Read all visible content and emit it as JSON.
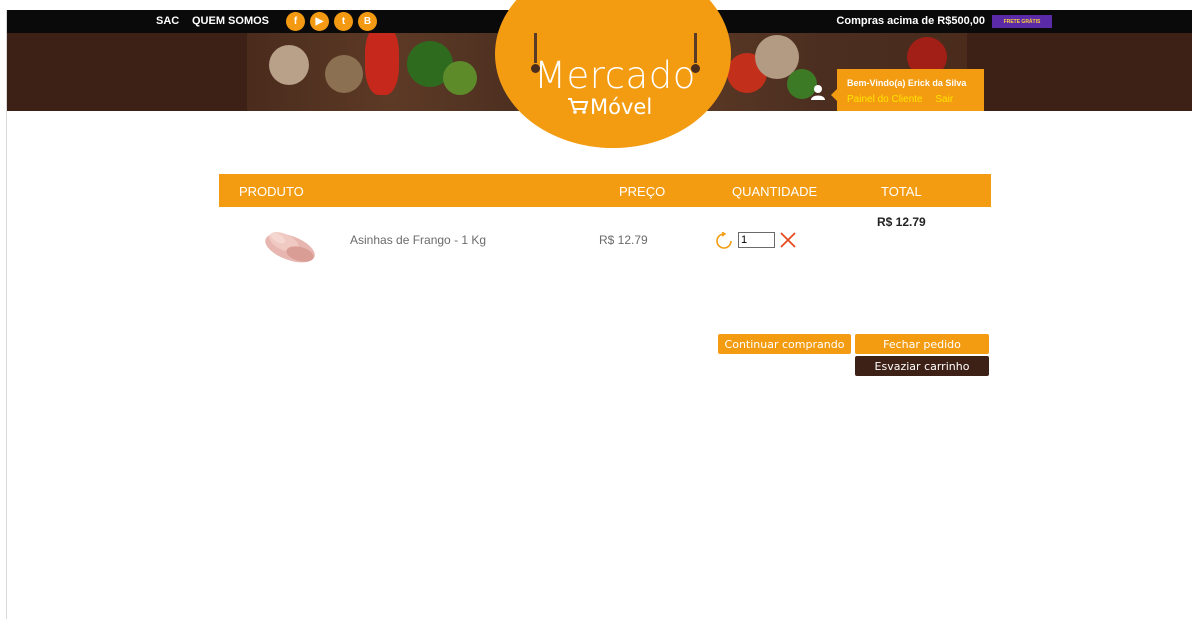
{
  "topbar": {
    "links": [
      "SAC",
      "QUEM SOMOS"
    ],
    "social": [
      {
        "icon": "facebook-icon",
        "glyph": "f"
      },
      {
        "icon": "youtube-icon",
        "glyph": "▶"
      },
      {
        "icon": "twitter-icon",
        "glyph": "t"
      },
      {
        "icon": "blog-icon",
        "glyph": "B"
      }
    ],
    "promo": "Compras acima de R$500,00",
    "badge": "FRETE GRÁTIS"
  },
  "logo": {
    "line1": "Mercado",
    "line2": "Móvel"
  },
  "user": {
    "greeting": "Bem-Vindo(a) Erick da Silva",
    "panel_link": "Painel do Cliente",
    "logout_link": "Sair"
  },
  "cart": {
    "headers": {
      "product": "PRODUTO",
      "price": "PREÇO",
      "quantity": "QUANTIDADE",
      "total": "TOTAL"
    },
    "items": [
      {
        "name": "Asinhas de Frango - 1 Kg",
        "price": "R$ 12.79",
        "quantity": "1"
      }
    ],
    "total": "R$ 12.79"
  },
  "actions": {
    "continue": "Continuar comprando",
    "checkout": "Fechar pedido",
    "empty": "Esvaziar carrinho"
  },
  "colors": {
    "accent": "#f39c12",
    "brown": "#3d2116",
    "topbar": "#0a0a0a",
    "badge": "#5b2aa7"
  }
}
